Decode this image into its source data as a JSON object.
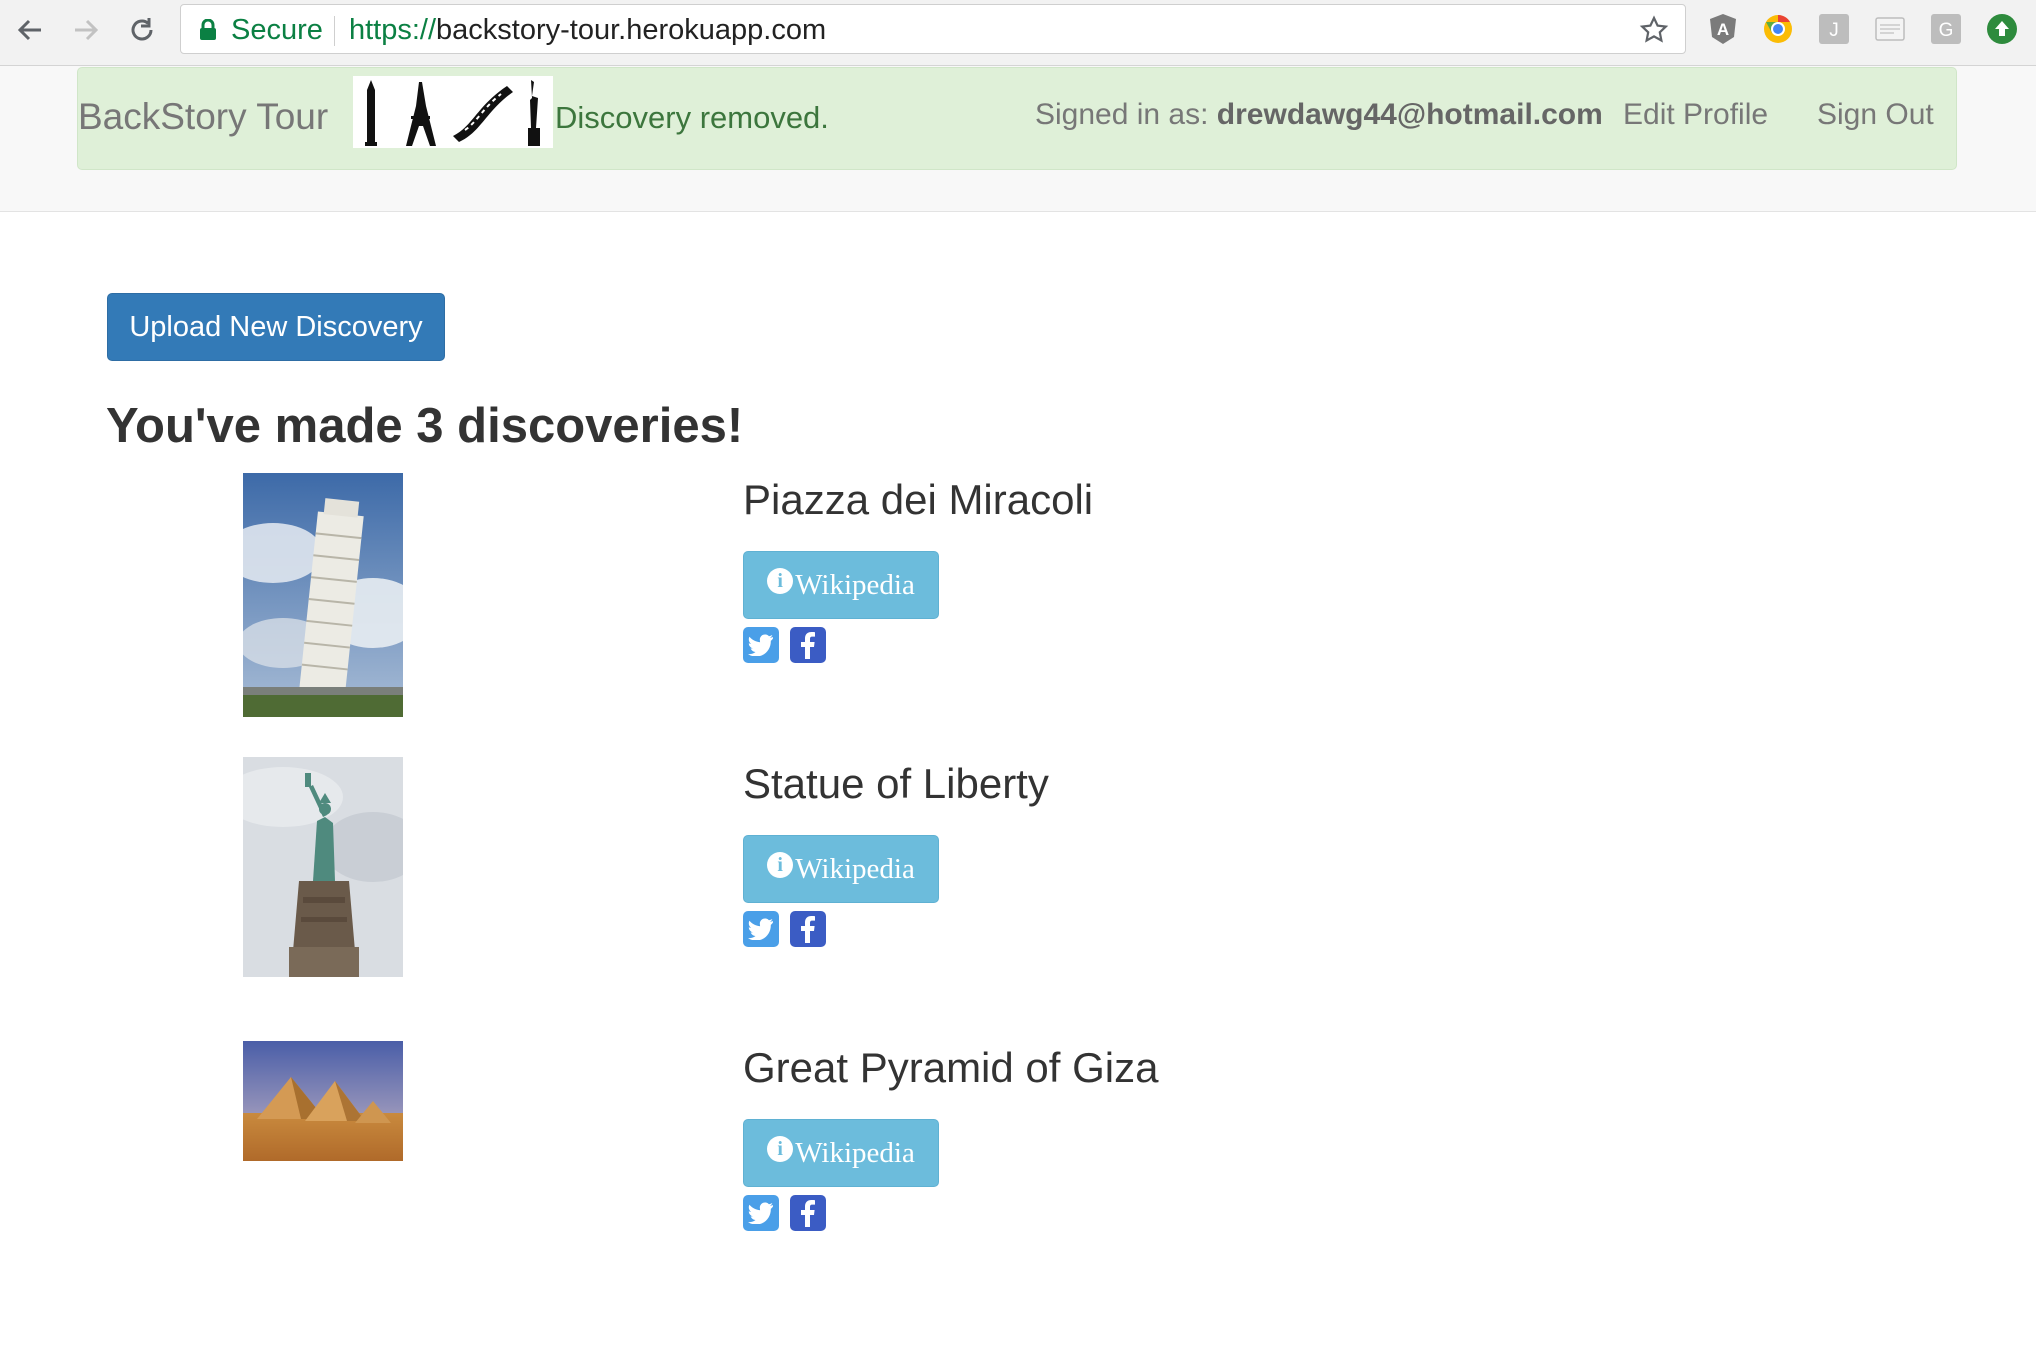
{
  "browser": {
    "secure_label": "Secure",
    "url_scheme": "https://",
    "url_host": "backstory-tour.herokuapp.com",
    "extensions": [
      "angular-icon",
      "chrome-color-icon",
      "j-extension-icon",
      "reader-icon",
      "g-extension-icon",
      "upload-icon"
    ]
  },
  "navbar": {
    "brand": "BackStory Tour",
    "flash_message": "Discovery removed.",
    "signed_in_prefix": "Signed in as: ",
    "signed_in_email": "drewdawg44@hotmail.com",
    "edit_profile": "Edit Profile",
    "sign_out": "Sign Out"
  },
  "main": {
    "upload_button": "Upload New Discovery",
    "heading": "You've made 3 discoveries!",
    "discoveries": [
      {
        "title": "Piazza dei Miracoli",
        "wiki_label": "Wikipedia"
      },
      {
        "title": "Statue of Liberty",
        "wiki_label": "Wikipedia"
      },
      {
        "title": "Great Pyramid of Giza",
        "wiki_label": "Wikipedia"
      }
    ]
  },
  "colors": {
    "primary": "#337ab7",
    "info": "#6cbcdc",
    "alert_bg": "#dff0d8",
    "alert_text": "#3c763d",
    "secure_green": "#0b8043"
  }
}
